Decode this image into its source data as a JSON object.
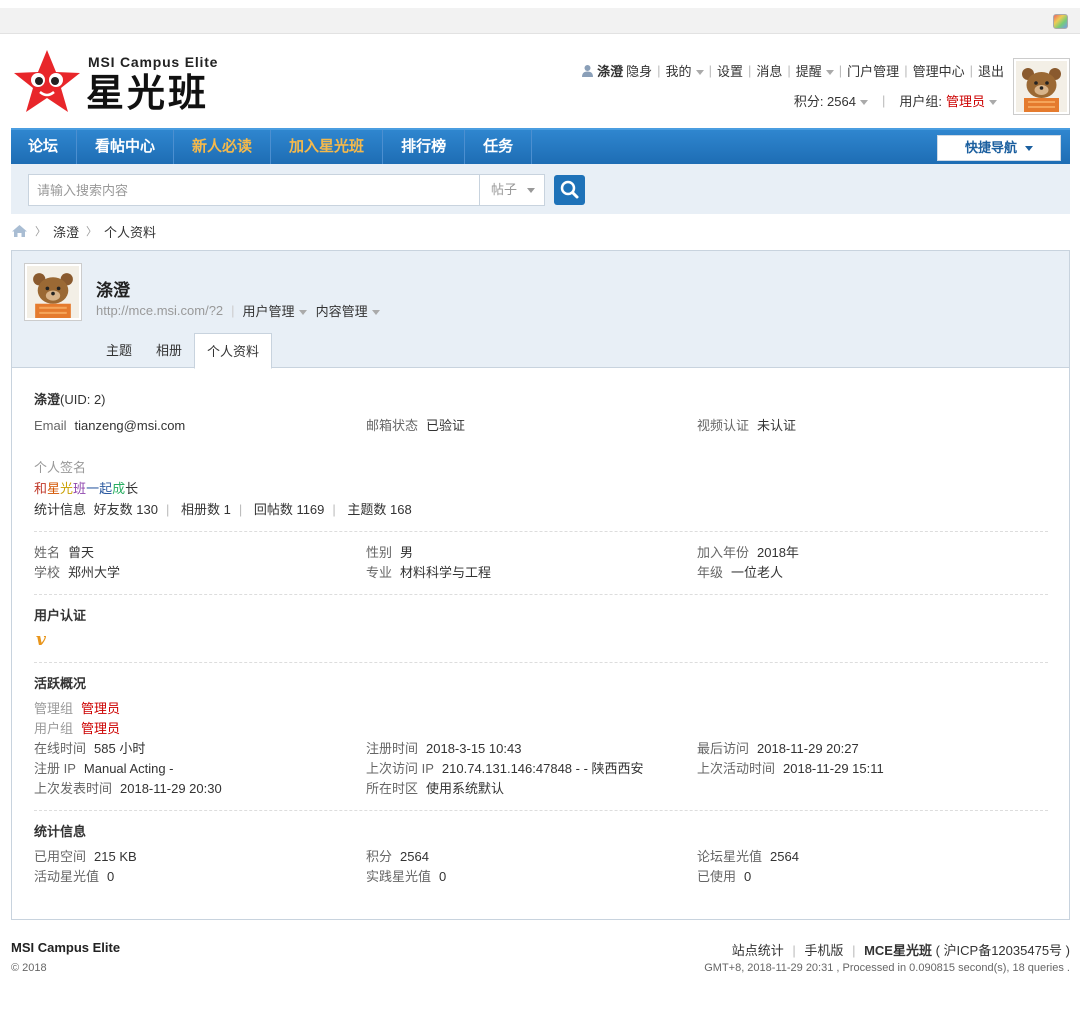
{
  "logo": {
    "en": "MSI Campus Elite",
    "cn": "星光班"
  },
  "user_nav": {
    "username": "涤澄",
    "invisible": "隐身",
    "mine": "我的",
    "settings": "设置",
    "messages": "消息",
    "reminders": "提醒",
    "portal_admin": "门户管理",
    "admin_center": "管理中心",
    "logout": "退出",
    "points_label": "积分: 2564",
    "usergroup_label": "用户组:",
    "usergroup_value": "管理员"
  },
  "main_nav": {
    "items": [
      "论坛",
      "看帖中心",
      "新人必读",
      "加入星光班",
      "排行榜",
      "任务"
    ],
    "quick_nav": "快捷导航"
  },
  "search": {
    "placeholder": "请输入搜索内容",
    "type": "帖子"
  },
  "breadcrumb": [
    "涤澄",
    "个人资料"
  ],
  "profile_head": {
    "name": "涤澄",
    "url": "http://mce.msi.com/?2",
    "user_admin": "用户管理",
    "content_admin": "内容管理",
    "tabs": [
      "主题",
      "相册",
      "个人资料"
    ]
  },
  "profile": {
    "name": "涤澄",
    "uid": "(UID: 2)",
    "email_label": "Email",
    "email": "tianzeng@msi.com",
    "email_status_label": "邮箱状态",
    "email_status": "已验证",
    "video_label": "视频认证",
    "video_status": "未认证",
    "signature_label": "个人签名",
    "signature_chars": [
      {
        "c": "和",
        "color": "#c0392b"
      },
      {
        "c": "星",
        "color": "#d35400"
      },
      {
        "c": "光",
        "color": "#c9a000"
      },
      {
        "c": "班",
        "color": "#8e44ad"
      },
      {
        "c": "一",
        "color": "#2c5aa0"
      },
      {
        "c": "起",
        "color": "#2c5aa0"
      },
      {
        "c": "成",
        "color": "#27ae60"
      },
      {
        "c": "长",
        "color": "#333333"
      }
    ],
    "stats_label": "统计信息",
    "stats": [
      "好友数 130",
      "相册数 1",
      "回帖数 1169",
      "主题数 168"
    ],
    "realname_label": "姓名",
    "realname": "曾天",
    "gender_label": "性别",
    "gender": "男",
    "join_year_label": "加入年份",
    "join_year": "2018年",
    "school_label": "学校",
    "school": "郑州大学",
    "major_label": "专业",
    "major": "材料科学与工程",
    "grade_label": "年级",
    "grade": "一位老人",
    "verify_title": "用户认证",
    "activity_title": "活跃概况",
    "admin_group_label": "管理组",
    "admin_group": "管理员",
    "user_group_label": "用户组",
    "user_group": "管理员",
    "online_label": "在线时间",
    "online": "585 小时",
    "reg_time_label": "注册时间",
    "reg_time": "2018-3-15 10:43",
    "last_visit_label": "最后访问",
    "last_visit": "2018-11-29 20:27",
    "reg_ip_label": "注册 IP",
    "reg_ip": "Manual Acting -",
    "last_ip_label": "上次访问 IP",
    "last_ip": "210.74.131.146:47848 - - 陕西西安",
    "last_active_label": "上次活动时间",
    "last_active": "2018-11-29 15:11",
    "last_post_label": "上次发表时间",
    "last_post": "2018-11-29 20:30",
    "timezone_label": "所在时区",
    "timezone": "使用系统默认",
    "stat_title": "统计信息",
    "space_label": "已用空间",
    "space": "215 KB",
    "points_label": "积分",
    "points": "2564",
    "forum_star_label": "论坛星光值",
    "forum_star": "2564",
    "activity_star_label": "活动星光值",
    "activity_star": "0",
    "practice_star_label": "实践星光值",
    "practice_star": "0",
    "used_label": "已使用",
    "used": "0"
  },
  "footer": {
    "site": "MSI Campus Elite",
    "copyright": "© 2018",
    "site_stats": "站点统计",
    "mobile": "手机版",
    "brand": "MCE星光班",
    "icp": "( 沪ICP备12035475号 )",
    "processed": "GMT+8, 2018-11-29 20:31 , Processed in 0.090815 second(s), 18 queries ."
  },
  "colors": {
    "nav_blue": "#1e6db4",
    "highlight_orange": "#f5b94b",
    "admin_red": "#cc0000",
    "head_bg": "#e8eff6"
  }
}
